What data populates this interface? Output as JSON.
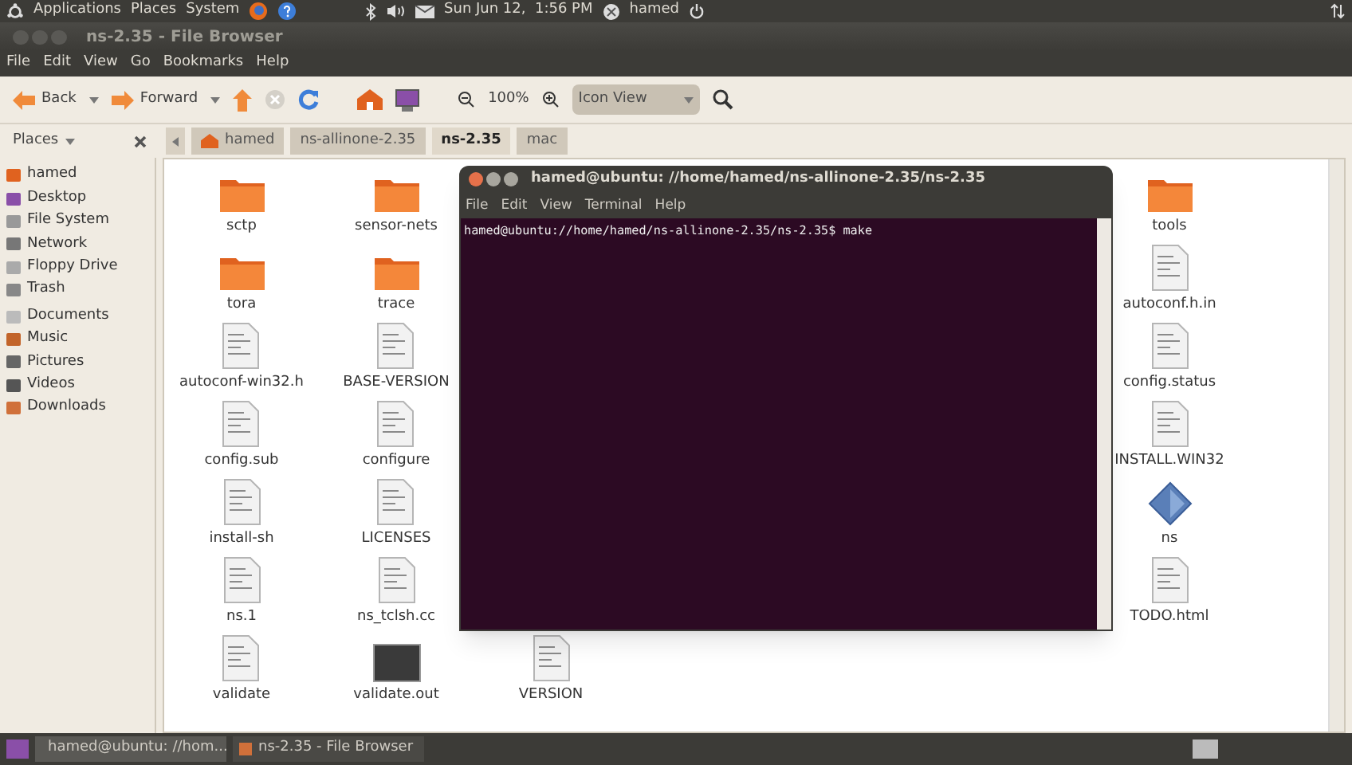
{
  "top_panel": {
    "menus": [
      "Applications",
      "Places",
      "System"
    ],
    "clock": "Sun Jun 12,  1:56 PM",
    "user": "hamed"
  },
  "window": {
    "title": "ns-2.35 - File Browser",
    "menu": [
      "File",
      "Edit",
      "View",
      "Go",
      "Bookmarks",
      "Help"
    ],
    "toolbar": {
      "back": "Back",
      "forward": "Forward",
      "zoom": "100%",
      "view": "Icon View"
    },
    "path": [
      {
        "label": "hamed",
        "selected": false
      },
      {
        "label": "ns-allinone-2.35",
        "selected": false
      },
      {
        "label": "ns-2.35",
        "selected": true
      },
      {
        "label": "mac",
        "selected": false
      }
    ],
    "sidebar": {
      "title": "Places",
      "items": [
        {
          "label": "hamed",
          "kind": "home"
        },
        {
          "label": "Desktop",
          "kind": "desktop"
        },
        {
          "label": "File System",
          "kind": "disk"
        },
        {
          "label": "Network",
          "kind": "network"
        },
        {
          "label": "Floppy Drive",
          "kind": "floppy"
        },
        {
          "label": "Trash",
          "kind": "trash"
        },
        {
          "label": "Documents",
          "kind": "folder"
        },
        {
          "label": "Music",
          "kind": "music"
        },
        {
          "label": "Pictures",
          "kind": "pictures"
        },
        {
          "label": "Videos",
          "kind": "videos"
        },
        {
          "label": "Downloads",
          "kind": "downloads"
        }
      ]
    },
    "files": [
      {
        "left": [
          {
            "name": "sctp",
            "kind": "folder"
          },
          {
            "name": "sensor-nets",
            "kind": "folder"
          }
        ],
        "right": {
          "name": "tools",
          "kind": "folder"
        }
      },
      {
        "left": [
          {
            "name": "tora",
            "kind": "folder"
          },
          {
            "name": "trace",
            "kind": "folder"
          }
        ],
        "right": {
          "name": "autoconf.h.in",
          "kind": "doc"
        }
      },
      {
        "left": [
          {
            "name": "autoconf-win32.h",
            "kind": "doc"
          },
          {
            "name": "BASE-VERSION",
            "kind": "doc"
          }
        ],
        "right": {
          "name": "config.status",
          "kind": "doc"
        }
      },
      {
        "left": [
          {
            "name": "config.sub",
            "kind": "doc"
          },
          {
            "name": "configure",
            "kind": "doc"
          }
        ],
        "right": {
          "name": "INSTALL.WIN32",
          "kind": "doc"
        }
      },
      {
        "left": [
          {
            "name": "install-sh",
            "kind": "doc"
          },
          {
            "name": "LICENSES",
            "kind": "doc"
          }
        ],
        "right": {
          "name": "ns",
          "kind": "binary"
        }
      },
      {
        "left": [
          {
            "name": "ns.1",
            "kind": "doc"
          },
          {
            "name": "ns_tclsh.cc",
            "kind": "doc"
          }
        ],
        "right": {
          "name": "TODO.html",
          "kind": "doc"
        }
      },
      {
        "left": [
          {
            "name": "validate",
            "kind": "doc"
          },
          {
            "name": "validate.out",
            "kind": "dark"
          },
          {
            "name": "VERSION",
            "kind": "doc"
          }
        ]
      }
    ]
  },
  "terminal": {
    "title": "hamed@ubuntu: //home/hamed/ns-allinone-2.35/ns-2.35",
    "menu": [
      "File",
      "Edit",
      "View",
      "Terminal",
      "Help"
    ],
    "lines": [
      "hamed@ubuntu://home/hamed/ns-allinone-2.35/ns-2.35$ make"
    ]
  },
  "taskbar": {
    "tasks": [
      "hamed@ubuntu: //hom...",
      "ns-2.35 - File Browser"
    ]
  }
}
